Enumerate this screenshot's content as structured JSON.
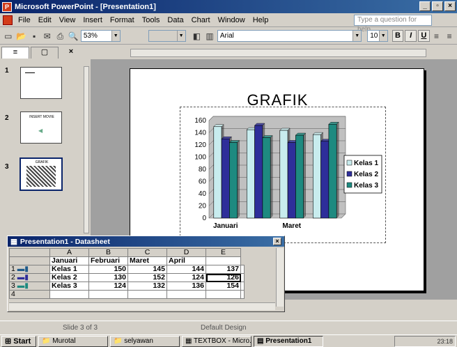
{
  "window": {
    "title": "Microsoft PowerPoint - [Presentation1]"
  },
  "menu": {
    "items": [
      "File",
      "Edit",
      "View",
      "Insert",
      "Format",
      "Tools",
      "Data",
      "Chart",
      "Window",
      "Help"
    ],
    "help_placeholder": "Type a question for help"
  },
  "toolbar": {
    "zoom": "53%",
    "font": "Arial",
    "size": "10",
    "bold": "B",
    "italic": "I",
    "underline": "U"
  },
  "slides_pane": {
    "numbers": [
      "1",
      "2",
      "3"
    ],
    "thumb2_title": "INSERT MOVIE",
    "thumb3_title": "GRAFIK"
  },
  "slide": {
    "title": "GRAFIK"
  },
  "chart_data": {
    "type": "bar",
    "categories": [
      "Januari",
      "Februari",
      "Maret",
      "April"
    ],
    "visible_xlabels": [
      "Januari",
      "Maret"
    ],
    "series": [
      {
        "name": "Kelas 1",
        "values": [
          150,
          145,
          144,
          137
        ],
        "color": "#c8ecee"
      },
      {
        "name": "Kelas 2",
        "values": [
          130,
          152,
          124,
          126
        ],
        "color": "#2e2e9a"
      },
      {
        "name": "Kelas 3",
        "values": [
          124,
          132,
          136,
          154
        ],
        "color": "#1e8a80"
      }
    ],
    "yticks": [
      "160",
      "140",
      "120",
      "100",
      "80",
      "60",
      "40",
      "20",
      "0"
    ],
    "ylim": [
      0,
      160
    ],
    "legend": "right",
    "style": "3d clustered column"
  },
  "datasheet": {
    "title": "Presentation1 - Datasheet",
    "col_letters": [
      "A",
      "B",
      "C",
      "D",
      "E"
    ],
    "headers": [
      "Januari",
      "Februari",
      "Maret",
      "April"
    ],
    "rows": [
      {
        "num": "1",
        "label": "Kelas 1",
        "values": [
          "150",
          "145",
          "144",
          "137"
        ]
      },
      {
        "num": "2",
        "label": "Kelas 2",
        "values": [
          "130",
          "152",
          "124",
          "126"
        ]
      },
      {
        "num": "3",
        "label": "Kelas 3",
        "values": [
          "124",
          "132",
          "136",
          "154"
        ]
      },
      {
        "num": "4",
        "label": "",
        "values": [
          "",
          "",
          "",
          ""
        ]
      }
    ]
  },
  "status": {
    "slide_info": "Slide 3 of 3",
    "design": "Default Design"
  },
  "taskbar": {
    "start": "Start",
    "items": [
      "Murotal",
      "selyawan",
      "TEXTBOX - Micro...",
      "Presentation1"
    ],
    "clock": "23:18"
  }
}
